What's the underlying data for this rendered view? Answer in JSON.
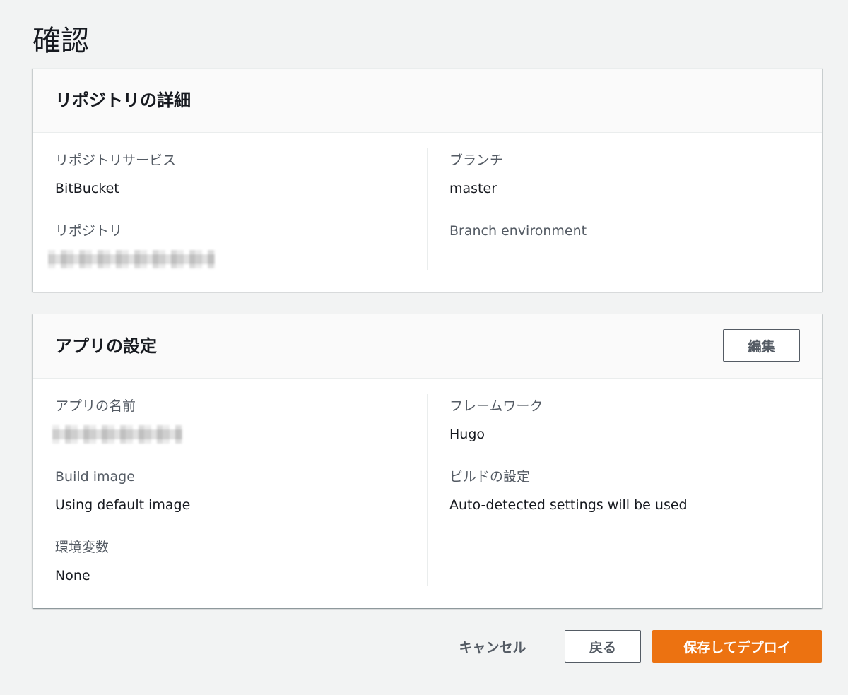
{
  "page": {
    "title": "確認"
  },
  "repository_card": {
    "title": "リポジトリの詳細",
    "fields": {
      "service": {
        "label": "リポジトリサービス",
        "value": "BitBucket"
      },
      "repository": {
        "label": "リポジトリ",
        "value": ""
      },
      "branch": {
        "label": "ブランチ",
        "value": "master"
      },
      "branch_env": {
        "label": "Branch environment",
        "value": ""
      }
    }
  },
  "app_card": {
    "title": "アプリの設定",
    "edit_label": "編集",
    "fields": {
      "app_name": {
        "label": "アプリの名前",
        "value": ""
      },
      "build_image": {
        "label": "Build image",
        "value": "Using default image"
      },
      "env_vars": {
        "label": "環境変数",
        "value": "None"
      },
      "framework": {
        "label": "フレームワーク",
        "value": "Hugo"
      },
      "build_settings": {
        "label": "ビルドの設定",
        "value": "Auto-detected settings will be used"
      }
    }
  },
  "footer": {
    "cancel_label": "キャンセル",
    "back_label": "戻る",
    "deploy_label": "保存してデプロイ"
  },
  "colors": {
    "background": "#f2f3f3",
    "primary_button": "#ec7211",
    "label_text": "#545b64",
    "value_text": "#16191f"
  }
}
